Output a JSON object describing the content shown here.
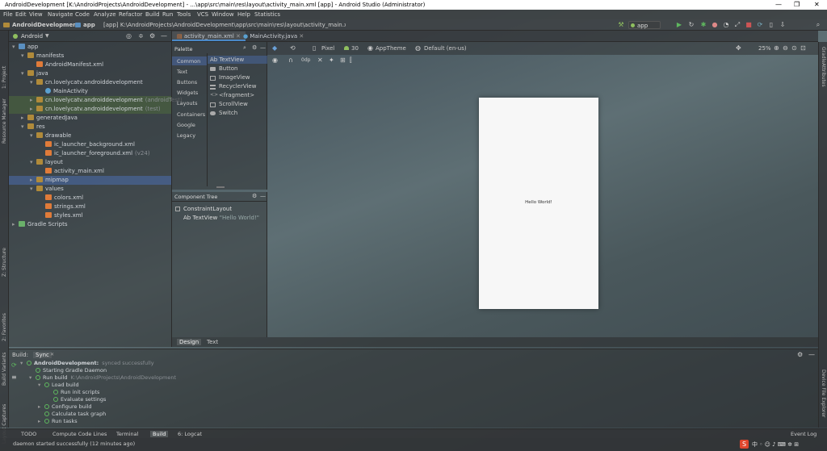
{
  "window": {
    "title": "AndroidDevelopment [K:\\AndroidProjects\\AndroidDevelopment] - ...\\app\\src\\main\\res\\layout\\activity_main.xml [app] - Android Studio (Administrator)"
  },
  "menu": [
    "File",
    "Edit",
    "View",
    "Navigate",
    "Code",
    "Analyze",
    "Refactor",
    "Build",
    "Run",
    "Tools",
    "VCS",
    "Window",
    "Help",
    "Statistics"
  ],
  "breadcrumb": {
    "project": "AndroidDevelopment",
    "module": "app",
    "path": "[app] K:\\AndroidProjects\\AndroidDevelopment\\app\\src\\main\\res\\layout\\activity_main.xml"
  },
  "run_config": "app",
  "project_view": {
    "mode": "Android",
    "tree": [
      {
        "label": "app",
        "level": 0
      },
      {
        "label": "manifests",
        "level": 1
      },
      {
        "label": "AndroidManifest.xml",
        "level": 2
      },
      {
        "label": "java",
        "level": 1
      },
      {
        "label": "cn.lovelycatv.androiddevelopment",
        "level": 2
      },
      {
        "label": "MainActivity",
        "level": 3
      },
      {
        "label": "cn.lovelycatv.androiddevelopment",
        "level": 2,
        "suffix": "(androidTest)"
      },
      {
        "label": "cn.lovelycatv.androiddevelopment",
        "level": 2,
        "suffix": "(test)"
      },
      {
        "label": "generatedJava",
        "level": 1
      },
      {
        "label": "res",
        "level": 1
      },
      {
        "label": "drawable",
        "level": 2
      },
      {
        "label": "ic_launcher_background.xml",
        "level": 3
      },
      {
        "label": "ic_launcher_foreground.xml",
        "level": 3,
        "suffix": "(v24)"
      },
      {
        "label": "layout",
        "level": 2
      },
      {
        "label": "activity_main.xml",
        "level": 3
      },
      {
        "label": "mipmap",
        "level": 2
      },
      {
        "label": "values",
        "level": 2
      },
      {
        "label": "colors.xml",
        "level": 3
      },
      {
        "label": "strings.xml",
        "level": 3
      },
      {
        "label": "styles.xml",
        "level": 3
      },
      {
        "label": "Gradle Scripts",
        "level": 0
      }
    ]
  },
  "editor_tabs": [
    "activity_main.xml",
    "MainActivity.java"
  ],
  "palette": {
    "title": "Palette",
    "categories": [
      "Common",
      "Text",
      "Buttons",
      "Widgets",
      "Layouts",
      "Containers",
      "Google",
      "Legacy"
    ],
    "items": [
      "Ab TextView",
      "Button",
      "ImageView",
      "RecyclerView",
      "<fragment>",
      "ScrollView",
      "Switch"
    ]
  },
  "component_tree": {
    "title": "Component Tree",
    "root": "ConstraintLayout",
    "child": "Ab TextView",
    "child_value": "- \"Hello World!\""
  },
  "design_toolbar": {
    "device": "Pixel",
    "api": "30",
    "theme": "AppTheme",
    "locale": "Default (en-us)",
    "zoom": "25%",
    "dp": "0dp"
  },
  "phone_text": "Hello World!",
  "design_tabs": [
    "Design",
    "Text"
  ],
  "build": {
    "tabs": [
      "Build:",
      "Sync"
    ],
    "rows": [
      {
        "label": "AndroidDevelopment:",
        "extra": "synced successfully",
        "level": 0
      },
      {
        "label": "Starting Gradle Daemon",
        "level": 1
      },
      {
        "label": "Run build",
        "extra": "K:\\AndroidProjects\\AndroidDevelopment",
        "level": 1
      },
      {
        "label": "Load build",
        "level": 2
      },
      {
        "label": "Run init scripts",
        "level": 3
      },
      {
        "label": "Evaluate settings",
        "level": 3
      },
      {
        "label": "Configure build",
        "level": 2
      },
      {
        "label": "Calculate task graph",
        "level": 2
      },
      {
        "label": "Run tasks",
        "level": 2
      }
    ]
  },
  "bottom_tabs": [
    "TODO",
    "Compute Code Lines",
    "Terminal",
    "Build",
    "6: Logcat"
  ],
  "event_log": "Event Log",
  "status": "daemon started successfully (12 minutes ago)",
  "side_tabs": {
    "left": [
      "1: Project",
      "Resource Manager",
      "Z: Structure",
      "2: Favorites",
      "Build Variants",
      "Layout Captures"
    ],
    "right": [
      "Gradle",
      "Attributes",
      "Device File Explorer"
    ]
  }
}
